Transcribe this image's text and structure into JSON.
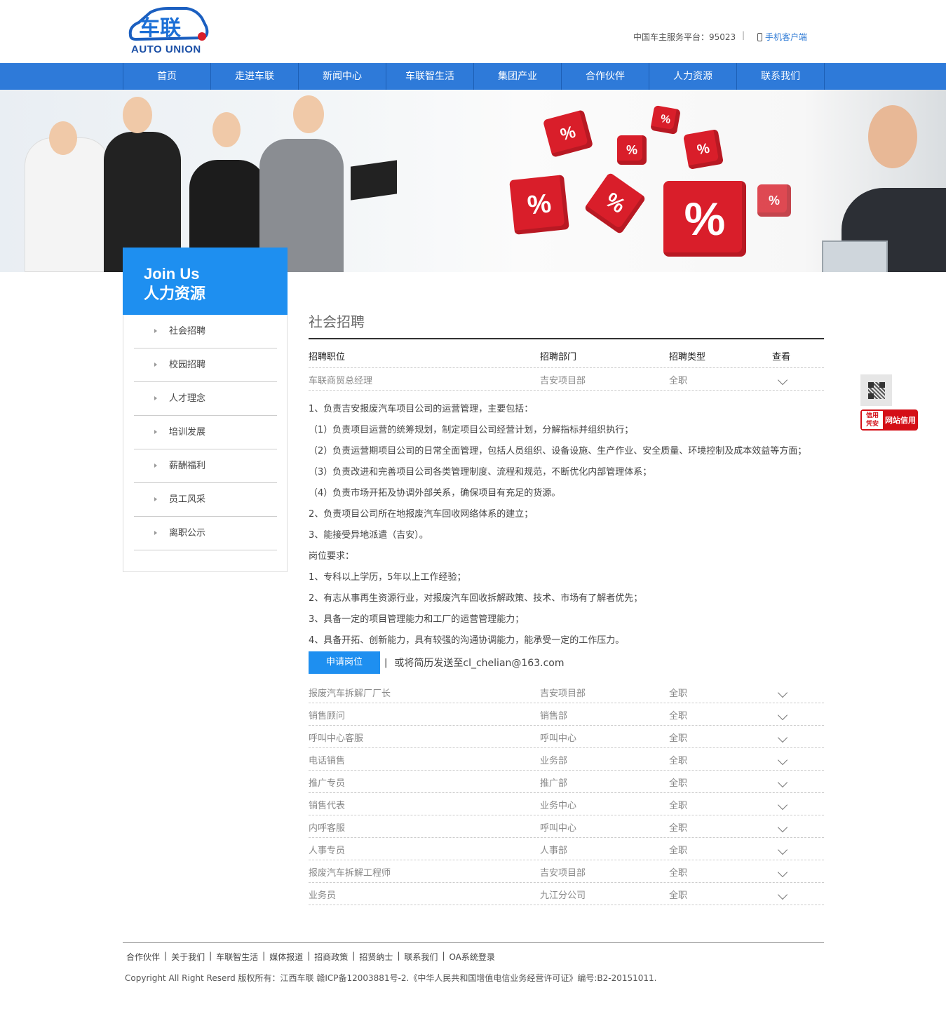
{
  "header": {
    "logo_cn": "车联",
    "logo_en": "AUTO UNION",
    "hotline": "中国车主服务平台：95023",
    "separator": "|",
    "mobile_client": "手机客户端"
  },
  "nav": [
    "首页",
    "走进车联",
    "新闻中心",
    "车联智生活",
    "集团产业",
    "合作伙伴",
    "人力资源",
    "联系我们"
  ],
  "sidebar": {
    "title_en": "Join Us",
    "title_cn": "人力资源",
    "items": [
      "社会招聘",
      "校园招聘",
      "人才理念",
      "培训发展",
      "薪酬福利",
      "员工风采",
      "离职公示"
    ]
  },
  "main": {
    "title": "社会招聘",
    "columns": [
      "招聘职位",
      "招聘部门",
      "招聘类型",
      "查看"
    ],
    "expanded_job": {
      "position": "车联商贸总经理",
      "department": "吉安项目部",
      "type": "全职"
    },
    "description": [
      "1、负责吉安报废汽车项目公司的运营管理，主要包括：",
      "（1）负责项目运营的统筹规划，制定项目公司经营计划，分解指标并组织执行；",
      "（2）负责运营期项目公司的日常全面管理，包括人员组织、设备设施、生产作业、安全质量、环境控制及成本效益等方面；",
      "（3）负责改进和完善项目公司各类管理制度、流程和规范，不断优化内部管理体系；",
      "（4）负责市场开拓及协调外部关系，确保项目有充足的货源。",
      "2、负责项目公司所在地报废汽车回收网络体系的建立；",
      "3、能接受异地派遣（吉安）。",
      "岗位要求：",
      "1、专科以上学历，5年以上工作经验；",
      "2、有志从事再生资源行业，对报废汽车回收拆解政策、技术、市场有了解者优先；",
      "3、具备一定的项目管理能力和工厂的运营管理能力；",
      "4、具备开拓、创新能力，具有较强的沟通协调能力，能承受一定的工作压力。"
    ],
    "apply_button": "申请岗位",
    "apply_separator": "|",
    "apply_note": "或将简历发送至cl_chelian@163.com",
    "jobs": [
      {
        "position": "报废汽车拆解厂厂长",
        "department": "吉安项目部",
        "type": "全职"
      },
      {
        "position": "销售顾问",
        "department": "销售部",
        "type": "全职"
      },
      {
        "position": "呼叫中心客服",
        "department": "呼叫中心",
        "type": "全职"
      },
      {
        "position": "电话销售",
        "department": "业务部",
        "type": "全职"
      },
      {
        "position": "推广专员",
        "department": "推广部",
        "type": "全职"
      },
      {
        "position": "销售代表",
        "department": "业务中心",
        "type": "全职"
      },
      {
        "position": "内呼客服",
        "department": "呼叫中心",
        "type": "全职"
      },
      {
        "position": "人事专员",
        "department": "人事部",
        "type": "全职"
      },
      {
        "position": "报废汽车拆解工程师",
        "department": "吉安项目部",
        "type": "全职"
      },
      {
        "position": "业务员",
        "department": "九江分公司",
        "type": "全职"
      }
    ]
  },
  "footer": {
    "links": [
      "合作伙伴",
      "关于我们",
      "车联智生活",
      "媒体报道",
      "招商政策",
      "招贤纳士",
      "联系我们",
      "OA系统登录"
    ],
    "copyright": "Copyright All Right Reserd 版权所有：江西车联 赣ICP备12003881号-2.《中华人民共和国增值电信业务经营许可证》编号:B2-20151011."
  },
  "floating": {
    "credit_badge": "信用 凭安",
    "credit_text": "网站信用"
  },
  "colors": {
    "nav_blue": "#2e7ad9",
    "accent_blue": "#1e8ff0",
    "credit_red": "#d40f17"
  },
  "banner": {
    "dice_symbol": "%"
  }
}
